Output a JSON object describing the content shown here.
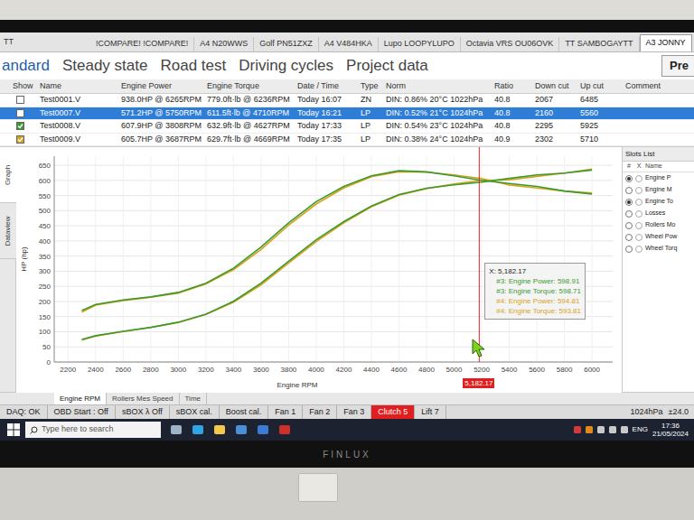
{
  "window": {
    "title": "TT"
  },
  "file_tabs": [
    {
      "label": "!COMPARE! !COMPARE!",
      "selected": false
    },
    {
      "label": "A4 N20WWS",
      "selected": false
    },
    {
      "label": "Golf PN51ZXZ",
      "selected": false
    },
    {
      "label": "A4 V484HKA",
      "selected": false
    },
    {
      "label": "Lupo LOOPYLUPO",
      "selected": false
    },
    {
      "label": "Octavia VRS OU06OVK",
      "selected": false
    },
    {
      "label": "TT SAMBOGAYTT",
      "selected": false
    },
    {
      "label": "A3 JONNY",
      "selected": true
    },
    {
      "label": "+",
      "selected": false
    }
  ],
  "mode_tabs": [
    {
      "label": "andard",
      "selected": true
    },
    {
      "label": "Steady state",
      "selected": false
    },
    {
      "label": "Road test",
      "selected": false
    },
    {
      "label": "Driving cycles",
      "selected": false
    },
    {
      "label": "Project data",
      "selected": false
    }
  ],
  "pre_button": "Pre",
  "table": {
    "columns": [
      "Show",
      "Name",
      "Engine Power",
      "Engine Torque",
      "Date / Time",
      "Type",
      "Norm",
      "Ratio",
      "Down cut",
      "Up cut",
      "Comment"
    ],
    "rows": [
      {
        "checked": false,
        "selected": false,
        "color": "#ffffff",
        "cells": [
          "Test0001.V",
          "938.0HP @ 6265RPM",
          "779.0ft·lb @ 6236RPM",
          "Today 16:07",
          "ZN",
          "DIN: 0.86% 20°C 1022hPa",
          "40.8",
          "2067",
          "6485"
        ]
      },
      {
        "checked": false,
        "selected": true,
        "color": "#ffffff",
        "cells": [
          "Test0007.V",
          "571.2HP @ 5750RPM",
          "611.5ft·lb @ 4710RPM",
          "Today 16:21",
          "LP",
          "DIN: 0.52% 21°C 1024hPa",
          "40.8",
          "2160",
          "5560"
        ]
      },
      {
        "checked": true,
        "selected": false,
        "color": "#3c9a2e",
        "cells": [
          "Test0008.V",
          "607.9HP @ 3808RPM",
          "632.9ft·lb @ 4627RPM",
          "Today 17:33",
          "LP",
          "DIN: 0.54% 23°C 1024hPa",
          "40.8",
          "2295",
          "5925"
        ]
      },
      {
        "checked": true,
        "selected": false,
        "color": "#d9a21b",
        "cells": [
          "Test0009.V",
          "605.7HP @ 3687RPM",
          "629.7ft·lb @ 4669RPM",
          "Today 17:35",
          "LP",
          "DIN: 0.38% 24°C 1024hPa",
          "40.9",
          "2302",
          "5710"
        ]
      }
    ]
  },
  "side_tabs": [
    {
      "label": "Graph",
      "selected": true
    },
    {
      "label": "Dataview",
      "selected": false
    }
  ],
  "chart": {
    "y_label": "HP (hp)",
    "x_label": "Engine RPM",
    "y_ticks": [
      "0",
      "50",
      "100",
      "150",
      "200",
      "250",
      "300",
      "350",
      "400",
      "450",
      "500",
      "550",
      "600",
      "650"
    ],
    "x_ticks": [
      "2200",
      "2400",
      "2600",
      "2800",
      "3000",
      "3200",
      "3400",
      "3600",
      "3800",
      "4000",
      "4200",
      "4400",
      "4600",
      "4800",
      "5000",
      "5200",
      "5400",
      "5600",
      "5800",
      "6000"
    ],
    "rpm": [
      2300,
      2400,
      2600,
      2800,
      3000,
      3200,
      3400,
      3600,
      3800,
      4000,
      4200,
      4400,
      4600,
      4800,
      5000,
      5200,
      5400,
      5600,
      5800,
      6000
    ],
    "series": [
      {
        "color": "#d9a21b",
        "values": [
          165,
          188,
          203,
          214,
          228,
          258,
          305,
          372,
          452,
          522,
          575,
          612,
          629,
          627,
          618,
          606,
          585,
          575,
          565,
          558
        ]
      },
      {
        "color": "#d9a21b",
        "values": [
          72.3,
          85.9,
          100.5,
          114.1,
          130.2,
          157.2,
          197.4,
          255.0,
          327.0,
          397.6,
          459.8,
          512.7,
          550.9,
          573.0,
          588.3,
          600.0,
          601.5,
          613.1,
          624.0,
          637.5
        ]
      },
      {
        "color": "#3c9a2e",
        "values": [
          170,
          190,
          205,
          215,
          230,
          260,
          310,
          380,
          460,
          530,
          580,
          615,
          632,
          628,
          615,
          600,
          590,
          580,
          565,
          555
        ]
      },
      {
        "color": "#3c9a2e",
        "values": [
          74.4,
          86.8,
          101.5,
          114.6,
          131.4,
          158.4,
          200.7,
          260.5,
          332.8,
          403.7,
          463.8,
          515.2,
          553.5,
          574.0,
          585.5,
          594.1,
          606.6,
          618.4,
          624.0,
          634.0
        ]
      }
    ],
    "cursor": {
      "rpm": 5182.17,
      "label": "5,182.17"
    },
    "tooltip": {
      "title": "X: 5,182.17",
      "lines": [
        {
          "text": "#3: Engine Power: 598.91",
          "color": "#3c9a2e"
        },
        {
          "text": "#3: Engine Torque: 598.71",
          "color": "#3c9a2e"
        },
        {
          "text": "#4: Engine Power: 594.81",
          "color": "#d9a21b"
        },
        {
          "text": "#4: Engine Torque: 593.81",
          "color": "#d9a21b"
        }
      ]
    }
  },
  "slots": {
    "title": "Slots List",
    "columns": [
      "#",
      "X",
      "Name"
    ],
    "items": [
      {
        "label": "Engine P",
        "selected": true
      },
      {
        "label": "Engine M",
        "selected": false
      },
      {
        "label": "Engine To",
        "selected": true
      },
      {
        "label": "Losses",
        "selected": false
      },
      {
        "label": "Rollers Mo",
        "selected": false
      },
      {
        "label": "Wheel Pow",
        "selected": false
      },
      {
        "label": "Wheel Torq",
        "selected": false
      }
    ]
  },
  "bottom_tabs": [
    {
      "label": "Engine RPM",
      "selected": true
    },
    {
      "label": "Rollers Mes Speed",
      "selected": false
    },
    {
      "label": "Time",
      "selected": false
    }
  ],
  "status_bar": {
    "items": [
      {
        "label": "DAQ: OK",
        "alert": false
      },
      {
        "label": "OBD Start : Off",
        "alert": false
      },
      {
        "label": "sBOX λ Off",
        "alert": false
      },
      {
        "label": "sBOX cal.",
        "alert": false
      },
      {
        "label": "Boost cal.",
        "alert": false
      },
      {
        "label": "Fan 1",
        "alert": false
      },
      {
        "label": "Fan 2",
        "alert": false
      },
      {
        "label": "Fan 3",
        "alert": false
      },
      {
        "label": "Clutch 5",
        "alert": true
      },
      {
        "label": "Lift 7",
        "alert": false
      }
    ],
    "pressure": "1024hPa",
    "temperature": "±24.0"
  },
  "taskbar": {
    "search": "Type here to search",
    "language": "ENG",
    "time": "17:36",
    "date": "21/05/2024"
  },
  "monitor": {
    "brand": "FINLUX"
  }
}
